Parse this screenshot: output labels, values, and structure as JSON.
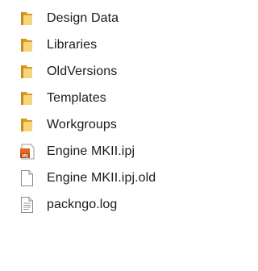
{
  "file_list": {
    "items": [
      {
        "name": "Design Data",
        "icon": "folder-icon"
      },
      {
        "name": "Libraries",
        "icon": "folder-icon"
      },
      {
        "name": "OldVersions",
        "icon": "folder-icon"
      },
      {
        "name": "Templates",
        "icon": "folder-icon"
      },
      {
        "name": "Workgroups",
        "icon": "folder-icon"
      },
      {
        "name": "Engine MKII.ipj",
        "icon": "ipj-project-file-icon",
        "icon_badge": "IPJ"
      },
      {
        "name": "Engine MKII.ipj.old",
        "icon": "blank-file-icon"
      },
      {
        "name": "packngo.log",
        "icon": "text-file-icon"
      }
    ]
  },
  "colors": {
    "folder_body": "#e8b23a",
    "folder_light": "#f6d57c",
    "ipj_orange": "#e06a1b",
    "text": "#1a1a1a"
  }
}
